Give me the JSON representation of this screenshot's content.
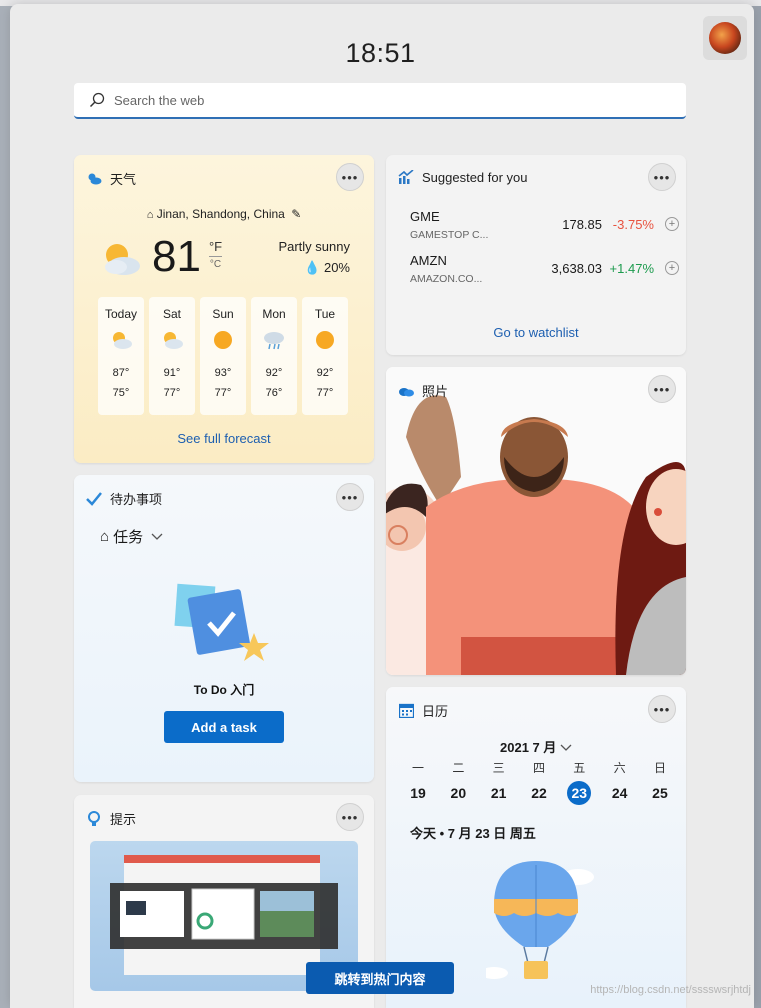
{
  "header": {
    "time": "18:51"
  },
  "search": {
    "placeholder": "Search the web"
  },
  "weather": {
    "title": "天气",
    "location": "Jinan, Shandong, China",
    "temp": "81",
    "unit_f": "°F",
    "unit_c": "°C",
    "condition": "Partly sunny",
    "precip": "20%",
    "days": [
      {
        "name": "Today",
        "icon": "partly-cloudy-icon",
        "hi": "87°",
        "lo": "75°"
      },
      {
        "name": "Sat",
        "icon": "partly-cloudy-icon",
        "hi": "91°",
        "lo": "77°"
      },
      {
        "name": "Sun",
        "icon": "sunny-icon",
        "hi": "93°",
        "lo": "77°"
      },
      {
        "name": "Mon",
        "icon": "rain-icon",
        "hi": "92°",
        "lo": "76°"
      },
      {
        "name": "Tue",
        "icon": "sunny-icon",
        "hi": "92°",
        "lo": "77°"
      }
    ],
    "forecast_link": "See full forecast"
  },
  "suggested": {
    "title": "Suggested for you",
    "stocks": [
      {
        "symbol": "GME",
        "name": "GAMESTOP C...",
        "price": "178.85",
        "change": "-3.75%",
        "color": "#e8523f"
      },
      {
        "symbol": "AMZN",
        "name": "AMAZON.CO...",
        "price": "3,638.03",
        "change": "+1.47%",
        "color": "#1d9b4e"
      }
    ],
    "watchlist_link": "Go to watchlist"
  },
  "todo": {
    "title": "待办事项",
    "list_name": "任务",
    "illustration_title": "To Do 入门",
    "add_button": "Add a task"
  },
  "photos": {
    "title": "照片"
  },
  "tips": {
    "title": "提示"
  },
  "calendar": {
    "title": "日历",
    "month": "2021 7 月",
    "weekdays": [
      "一",
      "二",
      "三",
      "四",
      "五",
      "六",
      "日"
    ],
    "dates": [
      "19",
      "20",
      "21",
      "22",
      "23",
      "24",
      "25"
    ],
    "today_index": 4,
    "today_line": "今天 • 7 月 23 日 周五"
  },
  "jump_button": "跳转到热门内容",
  "watermark": "https://blog.csdn.net/sssswsrjhtdj",
  "colors": {
    "accent": "#0b6cc9",
    "link": "#1d5fb0"
  }
}
